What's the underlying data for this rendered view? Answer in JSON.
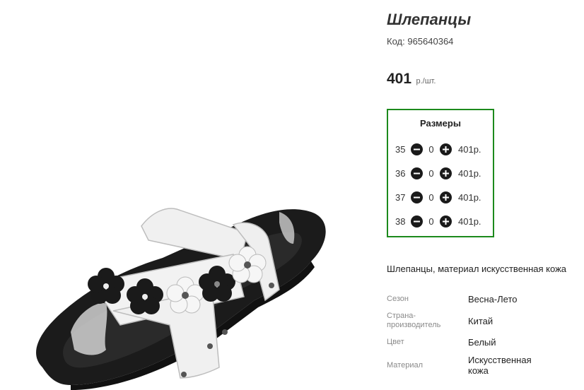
{
  "product": {
    "title": "Шлепанцы",
    "code_label": "Код:",
    "code": "965640364",
    "price": "401",
    "price_unit": "р./шт."
  },
  "sizes": {
    "title": "Размеры",
    "rows": [
      {
        "size": "35",
        "qty": "0",
        "price": "401р."
      },
      {
        "size": "36",
        "qty": "0",
        "price": "401р."
      },
      {
        "size": "37",
        "qty": "0",
        "price": "401р."
      },
      {
        "size": "38",
        "qty": "0",
        "price": "401р."
      }
    ]
  },
  "description": "Шлепанцы, материал искусственная кожа",
  "properties": [
    {
      "label": "Сезон",
      "value": "Весна-Лето"
    },
    {
      "label": "Страна-производитель",
      "value": "Китай"
    },
    {
      "label": "Цвет",
      "value": "Белый"
    },
    {
      "label": "Материал",
      "value": "Искусственная кожа"
    }
  ],
  "icons": {
    "minus": "minus-circle-icon",
    "plus": "plus-circle-icon"
  },
  "colors": {
    "sizes_border": "#1c8a1c",
    "button": "#1a1a1a"
  }
}
